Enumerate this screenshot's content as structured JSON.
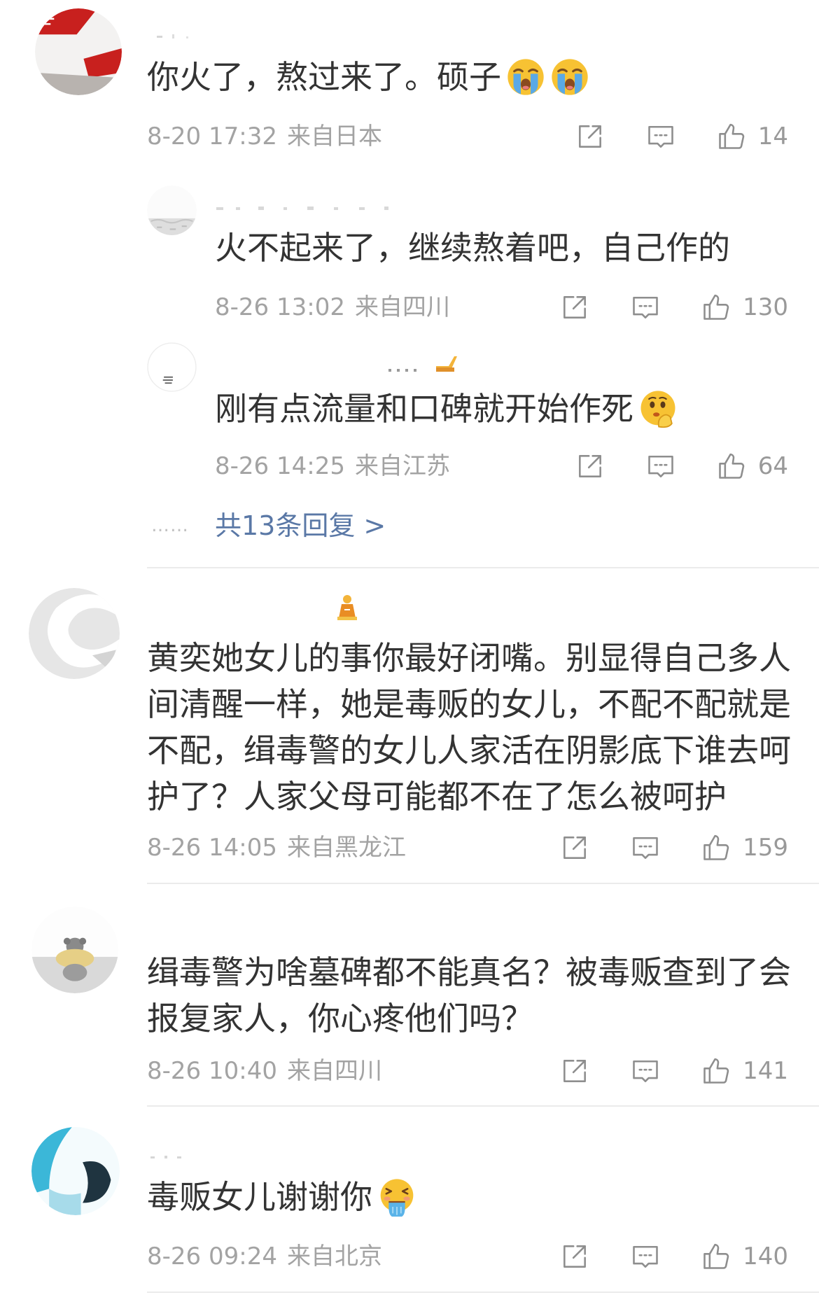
{
  "colors": {
    "background": "#ffffff",
    "text": "#333333",
    "meta": "#a3a3a3",
    "icon": "#8e8e8e",
    "link": "#5a78a6",
    "divider": "#ebebeb"
  },
  "icons": {
    "share": "share-icon",
    "comment": "comment-icon",
    "like": "like-icon"
  },
  "comments": [
    {
      "text": "你火了，熬过来了。硕子",
      "emojis": [
        "loudly-crying-face",
        "loudly-crying-face"
      ],
      "time": "8-20 17:32",
      "source": "来自日本",
      "likes": "14",
      "replies": [
        {
          "text": "火不起来了，继续熬着吧，自己作的",
          "time": "8-26 13:02",
          "source": "来自四川",
          "likes": "130"
        },
        {
          "text": "刚有点流量和口碑就开始作死",
          "emojis": [
            "thinking-face"
          ],
          "time": "8-26 14:25",
          "source": "来自江苏",
          "likes": "64"
        }
      ],
      "more_replies": {
        "dots": "……",
        "label": "共13条回复 >"
      }
    },
    {
      "text": "黄奕她女儿的事你最好闭嘴。别显得自己多人间清醒一样，她是毒贩的女儿，不配不配就是不配，缉毒警的女儿人家活在阴影底下谁去呵护了？人家父母可能都不在了怎么被呵护",
      "time": "8-26 14:05",
      "source": "来自黑龙江",
      "likes": "159"
    },
    {
      "text": "缉毒警为啥墓碑都不能真名？被毒贩查到了会报复家人，你心疼他们吗？",
      "time": "8-26 10:40",
      "source": "来自四川",
      "likes": "141"
    },
    {
      "text": "毒贩女儿谢谢你",
      "emojis": [
        "vomiting-face"
      ],
      "time": "8-26 09:24",
      "source": "来自北京",
      "likes": "140"
    }
  ]
}
